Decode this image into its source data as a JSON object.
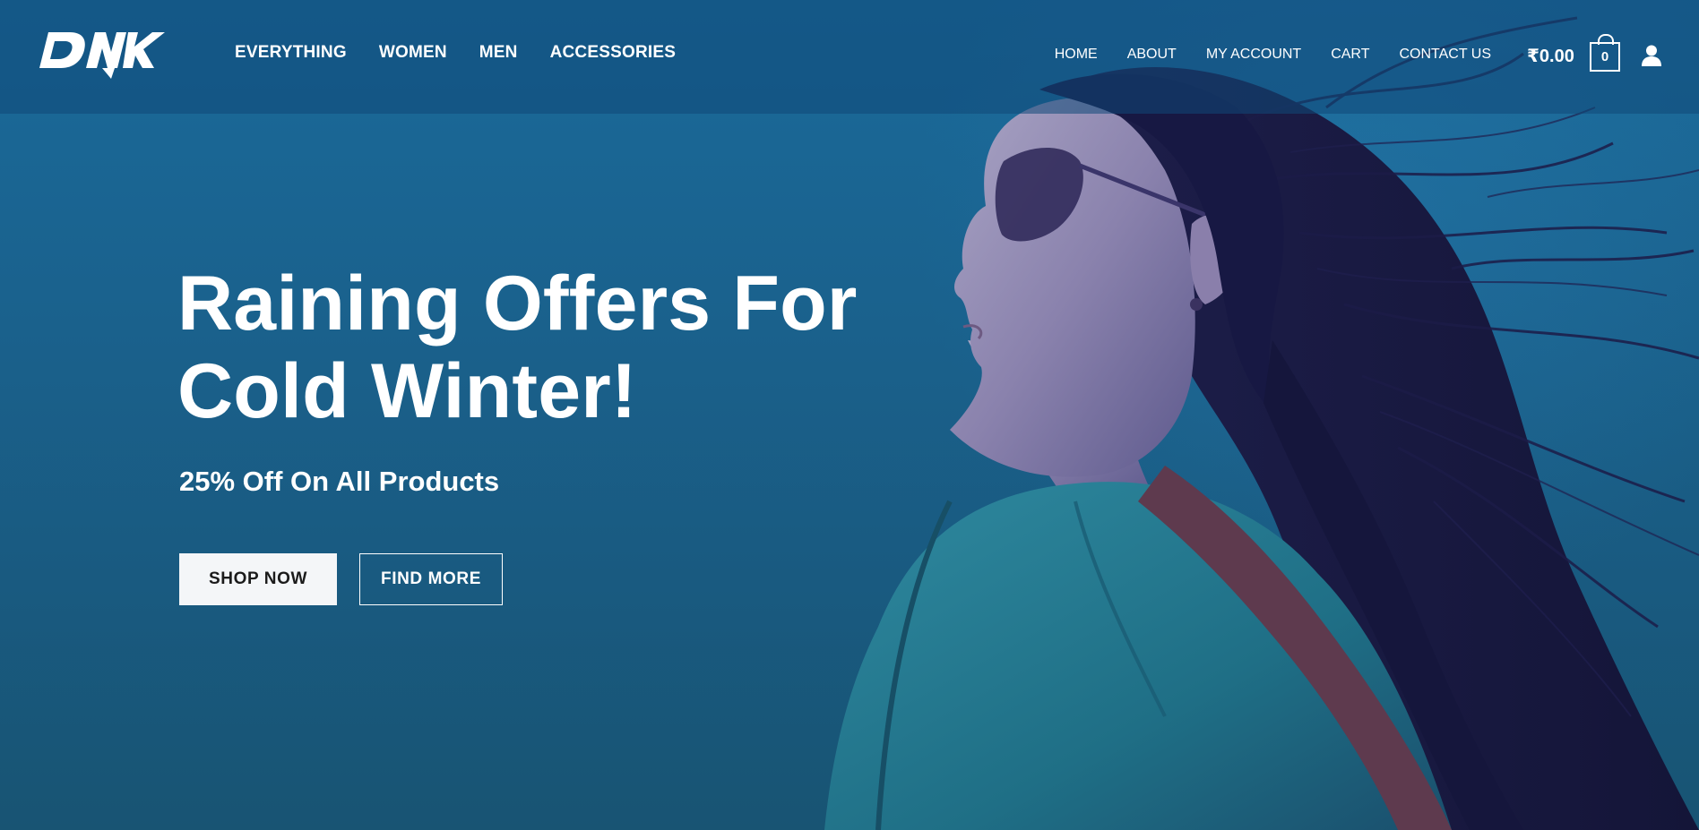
{
  "brand": {
    "logo_text": "DNK"
  },
  "nav_primary": [
    {
      "label": "EVERYTHING"
    },
    {
      "label": "WOMEN"
    },
    {
      "label": "MEN"
    },
    {
      "label": "ACCESSORIES"
    }
  ],
  "nav_secondary": [
    {
      "label": "HOME"
    },
    {
      "label": "ABOUT"
    },
    {
      "label": "MY ACCOUNT"
    },
    {
      "label": "CART"
    },
    {
      "label": "CONTACT US"
    }
  ],
  "cart": {
    "total": "₹0.00",
    "count": "0"
  },
  "user": {
    "icon": "user-icon"
  },
  "hero": {
    "title": "Raining Offers For Cold Winter!",
    "subtitle": "25% Off On All Products",
    "primary_button": "SHOP NOW",
    "secondary_button": "FIND MORE"
  },
  "colors": {
    "hero_blue": "#1a6a9a",
    "header_overlay": "#104878",
    "button_light": "#f4f6f8",
    "text": "#ffffff"
  }
}
